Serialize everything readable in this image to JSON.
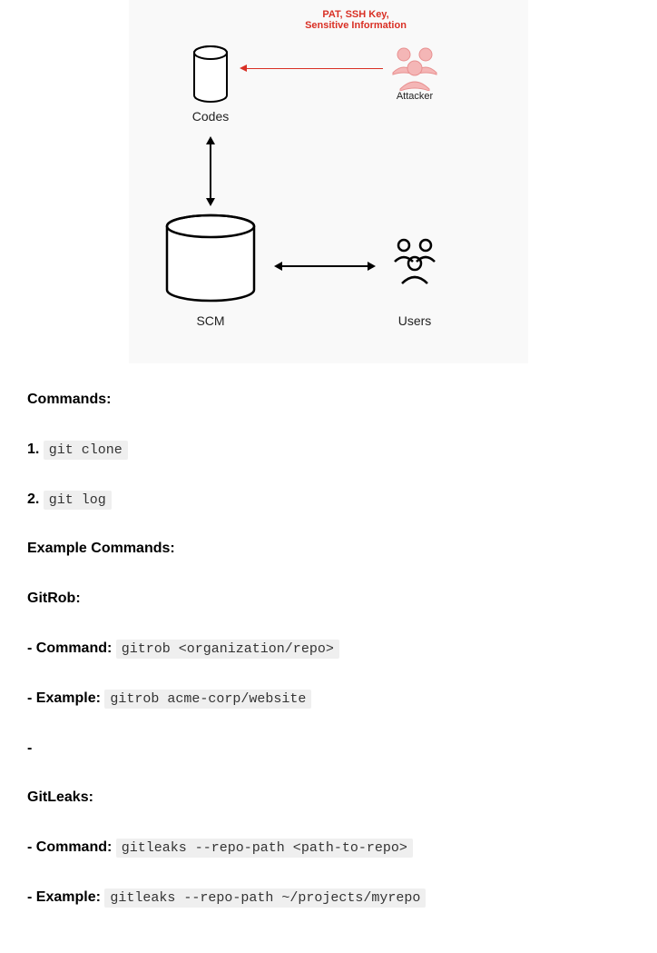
{
  "diagram": {
    "threat_label": "PAT, SSH Key, Sensitive Information",
    "codes_label": "Codes",
    "attacker_label": "Attacker",
    "scm_label": "SCM",
    "users_label": "Users"
  },
  "sections": {
    "commands_heading": "Commands:",
    "cmd1_num": "1.",
    "cmd1_code": "git clone",
    "cmd2_num": "2.",
    "cmd2_code": "git log",
    "example_commands_heading": "Example Commands:",
    "gitrob_heading": "GitRob:",
    "gitrob_command_label": "- Command:",
    "gitrob_command_code": "gitrob <organization/repo>",
    "gitrob_example_label": "- Example:",
    "gitrob_example_code": "gitrob acme-corp/website",
    "dash": "-",
    "gitleaks_heading": "GitLeaks:",
    "gitleaks_command_label": "- Command:",
    "gitleaks_command_code": "gitleaks --repo-path <path-to-repo>",
    "gitleaks_example_label": "- Example:",
    "gitleaks_example_code": "gitleaks --repo-path ~/projects/myrepo"
  }
}
